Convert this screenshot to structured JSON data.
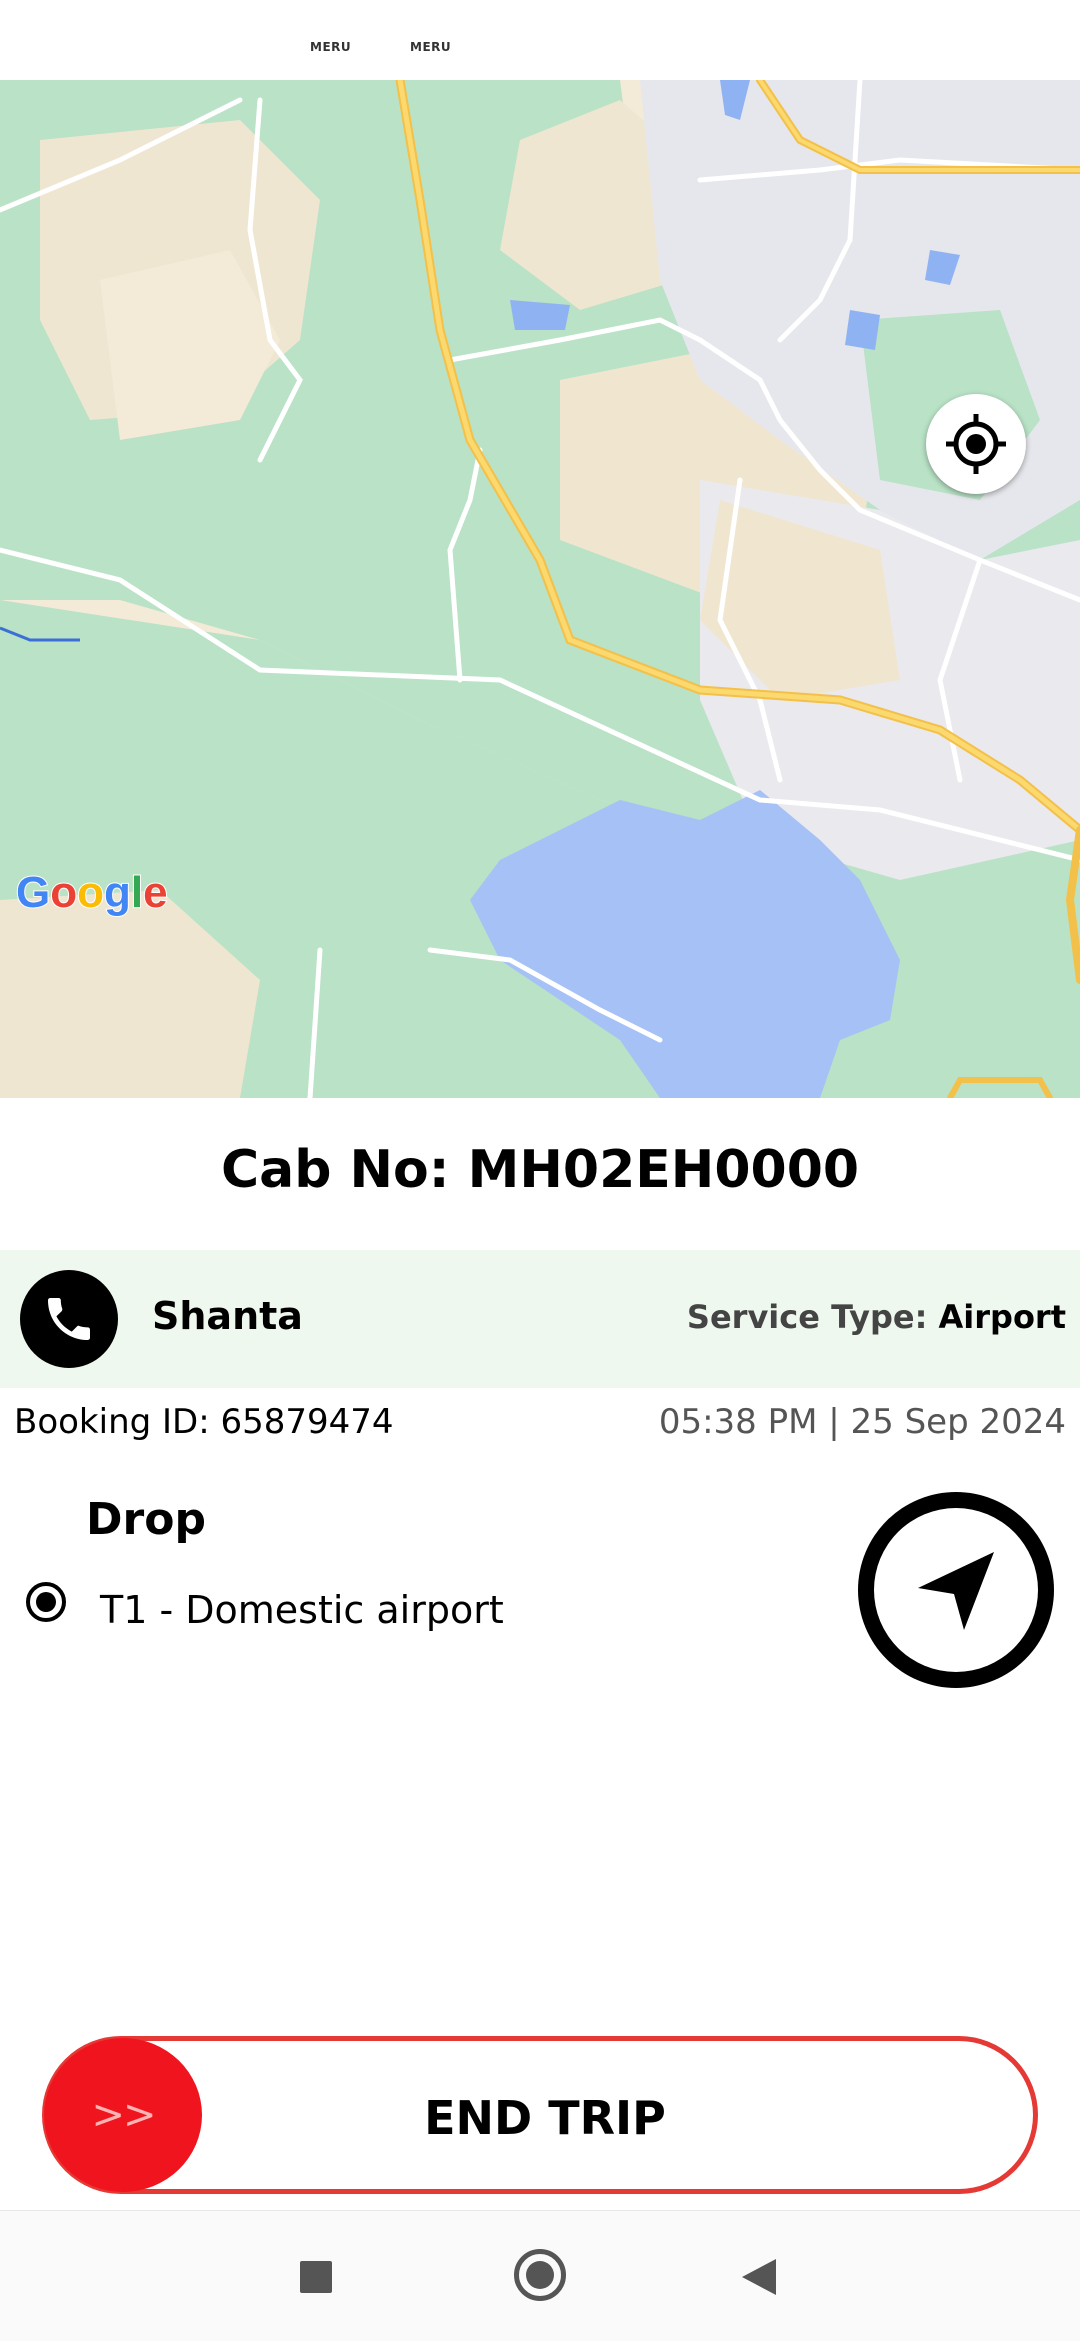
{
  "status_bar": {
    "logo_left": "MERU",
    "logo_right": "MERU"
  },
  "map": {
    "attribution": "Google",
    "locate_button": "my-location"
  },
  "trip": {
    "cab_number": "Cab No: MH02EH0000",
    "driver_name": "Shanta",
    "service_type_label": "Service Type:",
    "service_type_value": "Airport",
    "booking_id": "Booking ID: 65879474",
    "datetime": "05:38 PM | 25 Sep 2024",
    "drop_label": "Drop",
    "drop_address": "T1 - Domestic airport"
  },
  "actions": {
    "end_trip_label": "END TRIP",
    "slide_hint": ">>"
  },
  "colors": {
    "accent_red": "#f0141e",
    "driver_bar_bg": "#eef8ee"
  }
}
